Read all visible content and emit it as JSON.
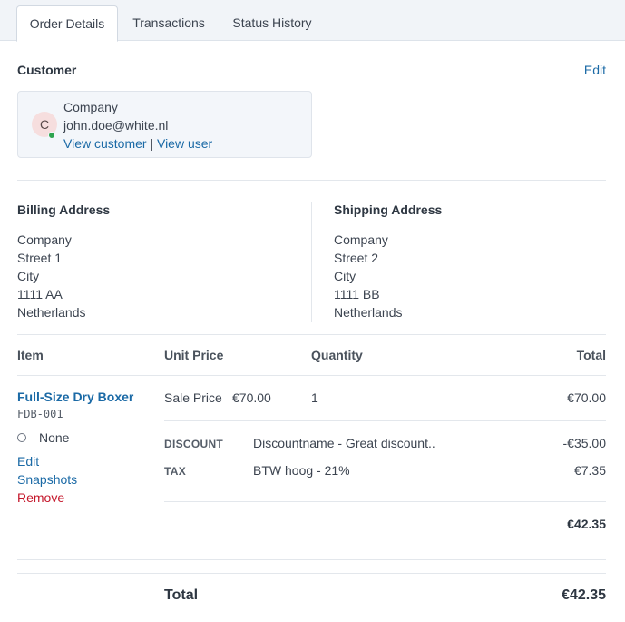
{
  "tabs": [
    {
      "label": "Order Details",
      "active": true
    },
    {
      "label": "Transactions",
      "active": false
    },
    {
      "label": "Status History",
      "active": false
    }
  ],
  "customer": {
    "heading": "Customer",
    "edit_label": "Edit",
    "avatar_initial": "C",
    "name": "Company",
    "email": "john.doe@white.nl",
    "view_customer": "View customer",
    "separator": "|",
    "view_user": "View user",
    "status_color": "#2ea44f"
  },
  "billing": {
    "heading": "Billing Address",
    "lines": [
      "Company",
      "Street 1",
      "City",
      "1111 AA",
      "Netherlands"
    ]
  },
  "shipping": {
    "heading": "Shipping Address",
    "lines": [
      "Company",
      "Street 2",
      "City",
      "1111 BB",
      "Netherlands"
    ]
  },
  "table": {
    "headers": {
      "item": "Item",
      "unit_price": "Unit Price",
      "quantity": "Quantity",
      "total": "Total"
    },
    "line_item": {
      "name": "Full-Size Dry Boxer",
      "sku": "FDB-001",
      "option_label": "None",
      "unit_price_label": "Sale Price",
      "unit_price": "€70.00",
      "quantity": "1",
      "total": "€70.00",
      "actions": {
        "edit": "Edit",
        "snapshots": "Snapshots",
        "remove": "Remove"
      }
    },
    "adjustments": [
      {
        "type": "DISCOUNT",
        "description": "Discountname - Great discount..",
        "amount": "-€35.00"
      },
      {
        "type": "TAX",
        "description": "BTW hoog - 21%",
        "amount": "€7.35"
      }
    ],
    "line_subtotal": "€42.35"
  },
  "order_total": {
    "label": "Total",
    "value": "€42.35"
  },
  "colors": {
    "link": "#1b6aa6",
    "remove": "#c4162a",
    "tabbar_bg": "#f1f4f8"
  }
}
